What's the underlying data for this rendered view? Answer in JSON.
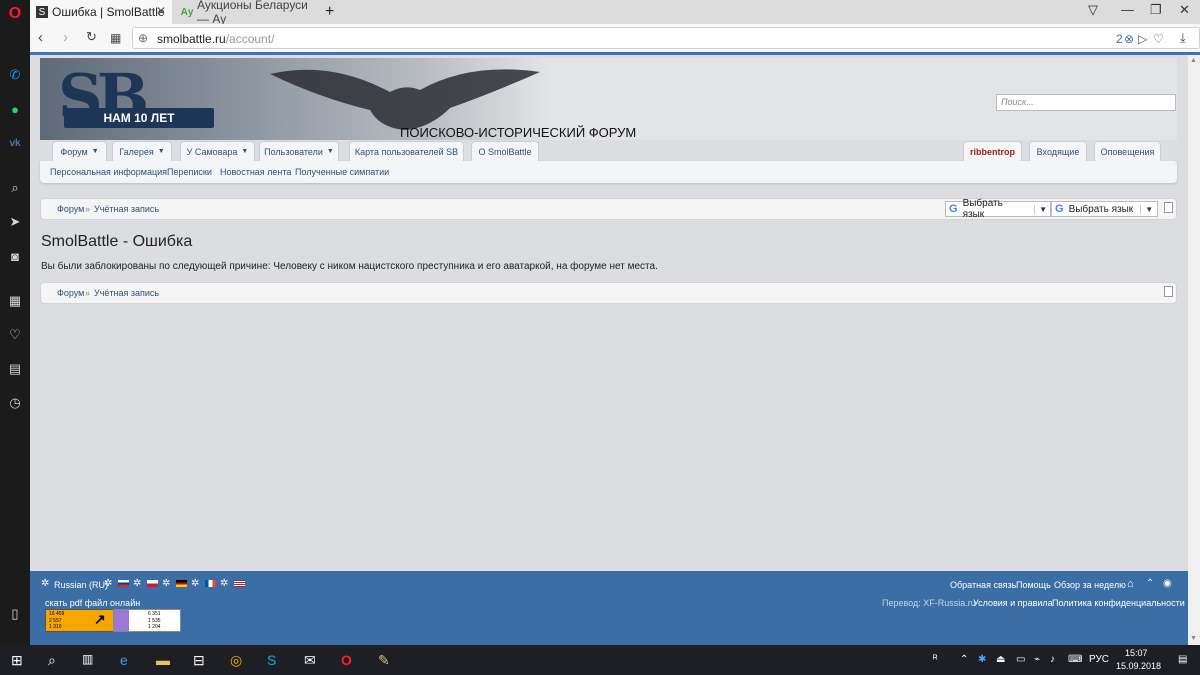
{
  "browser": {
    "tabs": [
      {
        "title": "Ошибка | SmolBattle",
        "favicon": "smolbattle-icon"
      },
      {
        "title": "Аукционы Беларуси — Ау",
        "favicon": "ay-icon"
      }
    ],
    "new_tab": "+",
    "badge_count": "2",
    "address": {
      "host": "smolbattle.ru",
      "path": "/account/"
    }
  },
  "site": {
    "logo_text": "SB",
    "logo_ribbon": "НАМ 10 ЛЕТ",
    "forum_title": "ПОИСКОВО-ИСТОРИЧЕСКИЙ ФОРУМ",
    "search_placeholder": "Поиск...",
    "nav_tabs": [
      "Форум",
      "Галерея",
      "У Самовара",
      "Пользователи",
      "Карта пользователей SB",
      "О SmolBattle"
    ],
    "user_tabs": [
      "ribbentrop",
      "Входящие",
      "Оповещения"
    ],
    "subnav": [
      "Персональная информация",
      "Переписки",
      "Новостная лента",
      "Полученные симпатии"
    ],
    "breadcrumb": [
      "Форум",
      "Учётная запись"
    ],
    "breadcrumb_sep": "»",
    "translate_label": "Выбрать язык",
    "page_title": "SmolBattle - Ошибка",
    "error_message": "Вы были заблокированы по следующей причине: Человеку с ником нацистского преступника и его аватаркой, на форуме нет места."
  },
  "footer": {
    "language": "Russian (RU)",
    "links_right": [
      "Обратная связь",
      "Помощь",
      "Обзор за неделю"
    ],
    "pdf_link": "скать pdf файл онлайн",
    "translation_credit": "Перевод: XF-Russia.ru",
    "legal_links": [
      "Условия и правила",
      "Политика конфиденциальности"
    ],
    "counter1": [
      "16 459",
      "2 557",
      "1 310"
    ],
    "counter2": [
      "6 351",
      "1 535",
      "1 204"
    ],
    "accent_color": "#3a6ea5"
  },
  "taskbar": {
    "lang": "РУС",
    "time": "15:07",
    "date": "15.09.2018"
  }
}
